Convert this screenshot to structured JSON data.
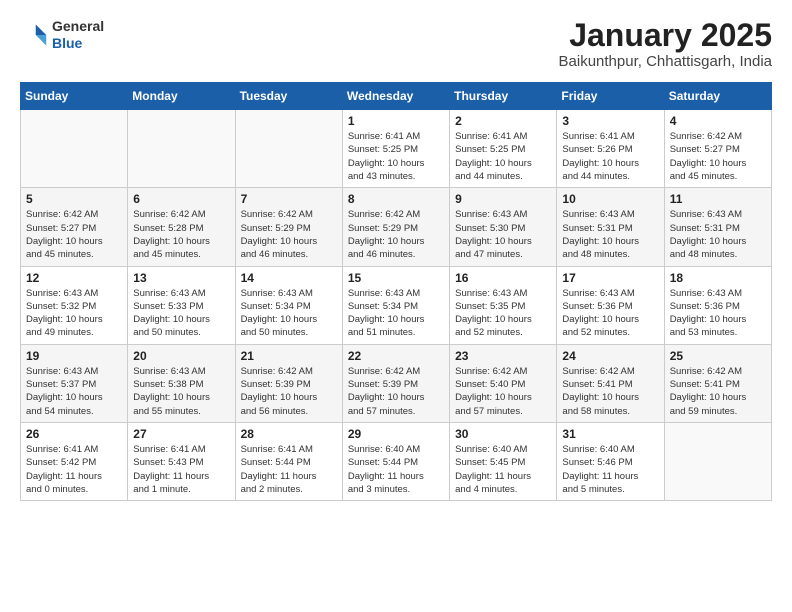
{
  "header": {
    "logo_general": "General",
    "logo_blue": "Blue",
    "title": "January 2025",
    "subtitle": "Baikunthpur, Chhattisgarh, India"
  },
  "weekdays": [
    "Sunday",
    "Monday",
    "Tuesday",
    "Wednesday",
    "Thursday",
    "Friday",
    "Saturday"
  ],
  "weeks": [
    [
      {
        "day": "",
        "info": ""
      },
      {
        "day": "",
        "info": ""
      },
      {
        "day": "",
        "info": ""
      },
      {
        "day": "1",
        "info": "Sunrise: 6:41 AM\nSunset: 5:25 PM\nDaylight: 10 hours\nand 43 minutes."
      },
      {
        "day": "2",
        "info": "Sunrise: 6:41 AM\nSunset: 5:25 PM\nDaylight: 10 hours\nand 44 minutes."
      },
      {
        "day": "3",
        "info": "Sunrise: 6:41 AM\nSunset: 5:26 PM\nDaylight: 10 hours\nand 44 minutes."
      },
      {
        "day": "4",
        "info": "Sunrise: 6:42 AM\nSunset: 5:27 PM\nDaylight: 10 hours\nand 45 minutes."
      }
    ],
    [
      {
        "day": "5",
        "info": "Sunrise: 6:42 AM\nSunset: 5:27 PM\nDaylight: 10 hours\nand 45 minutes."
      },
      {
        "day": "6",
        "info": "Sunrise: 6:42 AM\nSunset: 5:28 PM\nDaylight: 10 hours\nand 45 minutes."
      },
      {
        "day": "7",
        "info": "Sunrise: 6:42 AM\nSunset: 5:29 PM\nDaylight: 10 hours\nand 46 minutes."
      },
      {
        "day": "8",
        "info": "Sunrise: 6:42 AM\nSunset: 5:29 PM\nDaylight: 10 hours\nand 46 minutes."
      },
      {
        "day": "9",
        "info": "Sunrise: 6:43 AM\nSunset: 5:30 PM\nDaylight: 10 hours\nand 47 minutes."
      },
      {
        "day": "10",
        "info": "Sunrise: 6:43 AM\nSunset: 5:31 PM\nDaylight: 10 hours\nand 48 minutes."
      },
      {
        "day": "11",
        "info": "Sunrise: 6:43 AM\nSunset: 5:31 PM\nDaylight: 10 hours\nand 48 minutes."
      }
    ],
    [
      {
        "day": "12",
        "info": "Sunrise: 6:43 AM\nSunset: 5:32 PM\nDaylight: 10 hours\nand 49 minutes."
      },
      {
        "day": "13",
        "info": "Sunrise: 6:43 AM\nSunset: 5:33 PM\nDaylight: 10 hours\nand 50 minutes."
      },
      {
        "day": "14",
        "info": "Sunrise: 6:43 AM\nSunset: 5:34 PM\nDaylight: 10 hours\nand 50 minutes."
      },
      {
        "day": "15",
        "info": "Sunrise: 6:43 AM\nSunset: 5:34 PM\nDaylight: 10 hours\nand 51 minutes."
      },
      {
        "day": "16",
        "info": "Sunrise: 6:43 AM\nSunset: 5:35 PM\nDaylight: 10 hours\nand 52 minutes."
      },
      {
        "day": "17",
        "info": "Sunrise: 6:43 AM\nSunset: 5:36 PM\nDaylight: 10 hours\nand 52 minutes."
      },
      {
        "day": "18",
        "info": "Sunrise: 6:43 AM\nSunset: 5:36 PM\nDaylight: 10 hours\nand 53 minutes."
      }
    ],
    [
      {
        "day": "19",
        "info": "Sunrise: 6:43 AM\nSunset: 5:37 PM\nDaylight: 10 hours\nand 54 minutes."
      },
      {
        "day": "20",
        "info": "Sunrise: 6:43 AM\nSunset: 5:38 PM\nDaylight: 10 hours\nand 55 minutes."
      },
      {
        "day": "21",
        "info": "Sunrise: 6:42 AM\nSunset: 5:39 PM\nDaylight: 10 hours\nand 56 minutes."
      },
      {
        "day": "22",
        "info": "Sunrise: 6:42 AM\nSunset: 5:39 PM\nDaylight: 10 hours\nand 57 minutes."
      },
      {
        "day": "23",
        "info": "Sunrise: 6:42 AM\nSunset: 5:40 PM\nDaylight: 10 hours\nand 57 minutes."
      },
      {
        "day": "24",
        "info": "Sunrise: 6:42 AM\nSunset: 5:41 PM\nDaylight: 10 hours\nand 58 minutes."
      },
      {
        "day": "25",
        "info": "Sunrise: 6:42 AM\nSunset: 5:41 PM\nDaylight: 10 hours\nand 59 minutes."
      }
    ],
    [
      {
        "day": "26",
        "info": "Sunrise: 6:41 AM\nSunset: 5:42 PM\nDaylight: 11 hours\nand 0 minutes."
      },
      {
        "day": "27",
        "info": "Sunrise: 6:41 AM\nSunset: 5:43 PM\nDaylight: 11 hours\nand 1 minute."
      },
      {
        "day": "28",
        "info": "Sunrise: 6:41 AM\nSunset: 5:44 PM\nDaylight: 11 hours\nand 2 minutes."
      },
      {
        "day": "29",
        "info": "Sunrise: 6:40 AM\nSunset: 5:44 PM\nDaylight: 11 hours\nand 3 minutes."
      },
      {
        "day": "30",
        "info": "Sunrise: 6:40 AM\nSunset: 5:45 PM\nDaylight: 11 hours\nand 4 minutes."
      },
      {
        "day": "31",
        "info": "Sunrise: 6:40 AM\nSunset: 5:46 PM\nDaylight: 11 hours\nand 5 minutes."
      },
      {
        "day": "",
        "info": ""
      }
    ]
  ]
}
